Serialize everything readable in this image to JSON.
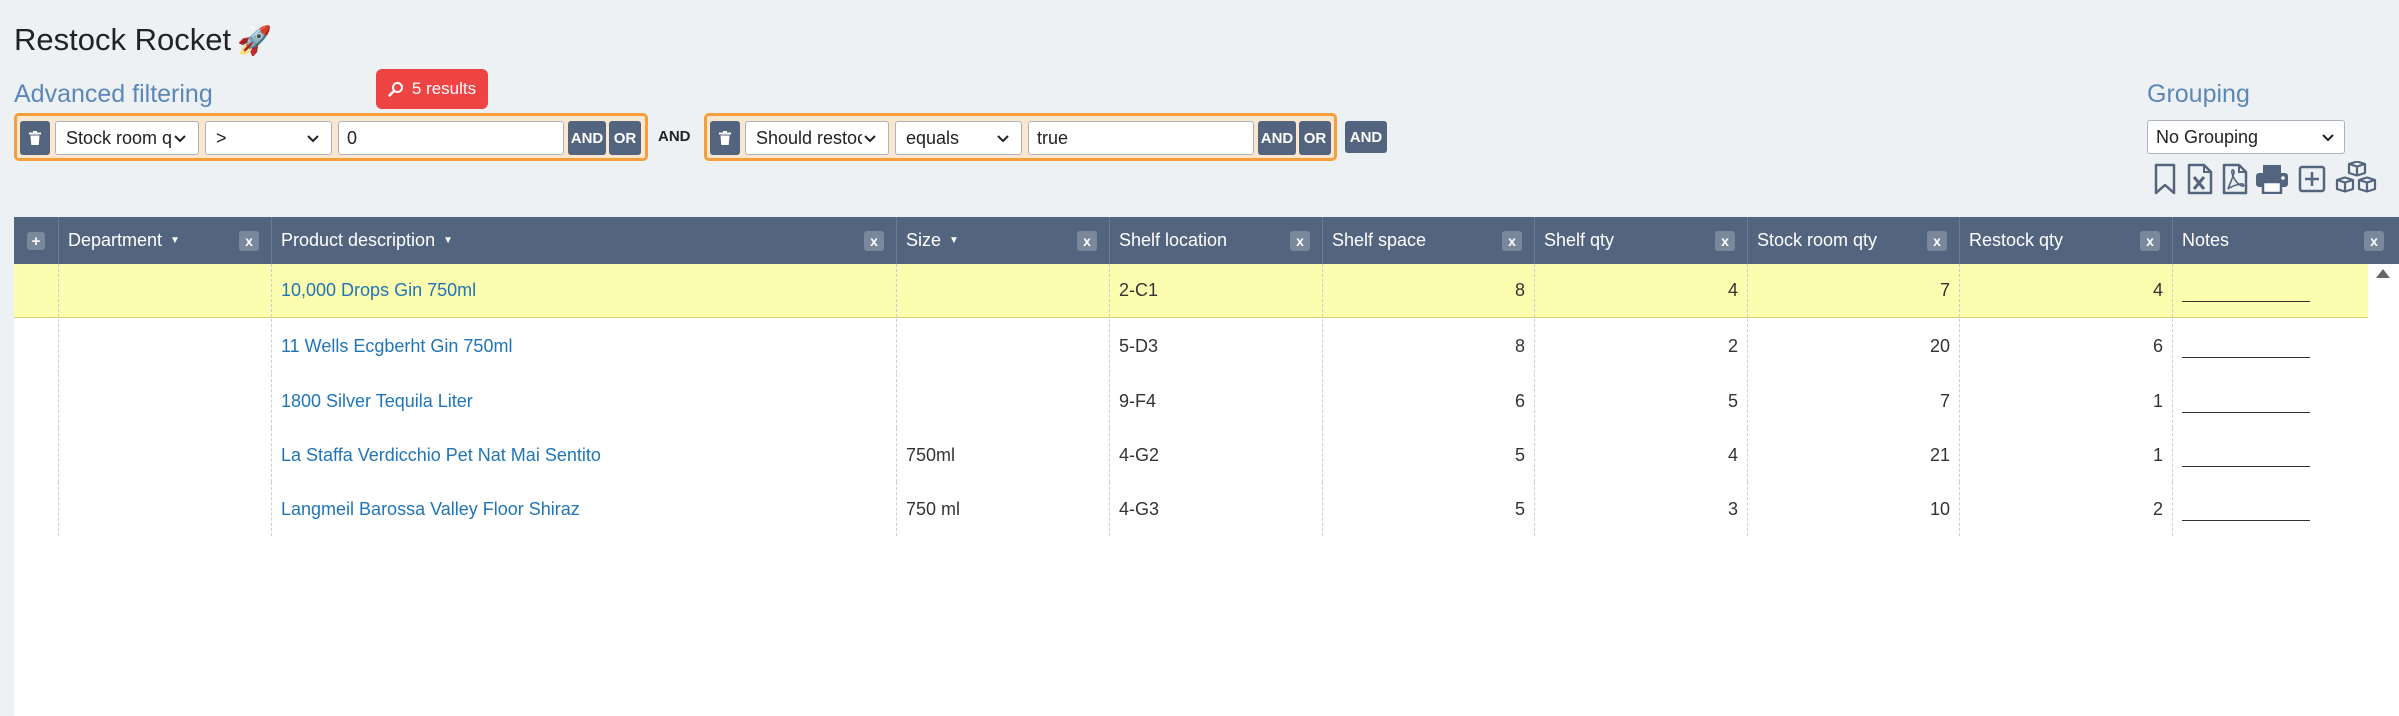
{
  "app": {
    "title": "Restock Rocket",
    "emoji": "🚀"
  },
  "filtering": {
    "label": "Advanced filtering",
    "results": "5 results",
    "connector": "AND",
    "add_button": "AND",
    "groups": [
      {
        "field": "Stock room q",
        "operator": ">",
        "value": "0",
        "and_label": "AND",
        "or_label": "OR"
      },
      {
        "field": "Should restoc",
        "operator": "equals",
        "value": "true",
        "and_label": "AND",
        "or_label": "OR"
      }
    ]
  },
  "grouping": {
    "label": "Grouping",
    "selected": "No Grouping"
  },
  "toolbar": [
    "bookmark-icon",
    "excel-icon",
    "pdf-icon",
    "print-icon",
    "add-column-icon",
    "boxes-icon"
  ],
  "table": {
    "columns": [
      {
        "label": "Department",
        "sortable": true
      },
      {
        "label": "Product description",
        "sortable": true
      },
      {
        "label": "Size",
        "sortable": true
      },
      {
        "label": "Shelf location",
        "sortable": false
      },
      {
        "label": "Shelf space",
        "sortable": false
      },
      {
        "label": "Shelf qty",
        "sortable": false
      },
      {
        "label": "Stock room qty",
        "sortable": false
      },
      {
        "label": "Restock qty",
        "sortable": false
      },
      {
        "label": "Notes",
        "sortable": false
      }
    ],
    "remove_label": "x",
    "add_label": "+",
    "rows": [
      {
        "department": "",
        "product": "10,000 Drops Gin 750ml",
        "size": "",
        "shelf_location": "2-C1",
        "shelf_space": "8",
        "shelf_qty": "4",
        "stock_room_qty": "7",
        "restock_qty": "4",
        "highlight": true
      },
      {
        "department": "",
        "product": "11 Wells Ecgberht Gin 750ml",
        "size": "",
        "shelf_location": "5-D3",
        "shelf_space": "8",
        "shelf_qty": "2",
        "stock_room_qty": "20",
        "restock_qty": "6",
        "highlight": false
      },
      {
        "department": "",
        "product": "1800 Silver Tequila Liter",
        "size": "",
        "shelf_location": "9-F4",
        "shelf_space": "6",
        "shelf_qty": "5",
        "stock_room_qty": "7",
        "restock_qty": "1",
        "highlight": false
      },
      {
        "department": "",
        "product": "La Staffa Verdicchio Pet Nat Mai Sentito",
        "size": "750ml",
        "shelf_location": "4-G2",
        "shelf_space": "5",
        "shelf_qty": "4",
        "stock_room_qty": "21",
        "restock_qty": "1",
        "highlight": false
      },
      {
        "department": "",
        "product": "Langmeil Barossa Valley Floor Shiraz",
        "size": "750 ml",
        "shelf_location": "4-G3",
        "shelf_space": "5",
        "shelf_qty": "3",
        "stock_room_qty": "10",
        "restock_qty": "2",
        "highlight": false
      }
    ]
  }
}
